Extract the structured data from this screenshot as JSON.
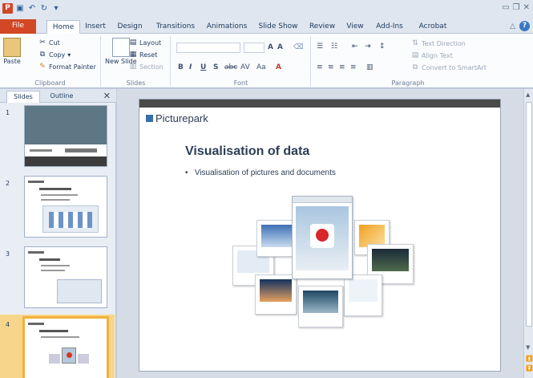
{
  "app": {
    "icon_letter": "P"
  },
  "tabs": [
    "File",
    "Home",
    "Insert",
    "Design",
    "Transitions",
    "Animations",
    "Slide Show",
    "Review",
    "View",
    "Add-Ins",
    "Acrobat"
  ],
  "ribbon": {
    "clipboard": {
      "paste": "Paste",
      "cut": "Cut",
      "copy": "Copy",
      "format_painter": "Format Painter",
      "label": "Clipboard"
    },
    "slides": {
      "new_slide": "New Slide",
      "layout": "Layout",
      "reset": "Reset",
      "section": "Section",
      "label": "Slides"
    },
    "font": {
      "label": "Font"
    },
    "paragraph": {
      "text_direction": "Text Direction",
      "align_text": "Align Text",
      "convert_smartart": "Convert to SmartArt",
      "label": "Paragraph"
    }
  },
  "pane": {
    "tab_slides": "Slides",
    "tab_outline": "Outline",
    "thumbs": [
      "1",
      "2",
      "3",
      "4"
    ]
  },
  "slide": {
    "brand": "Picturepark",
    "title": "Visualisation of data",
    "bullet": "Visualisation of pictures and documents"
  },
  "colors": {
    "file_tab": "#d24726",
    "accent": "#3a78c5",
    "selection": "#f0b13b"
  }
}
